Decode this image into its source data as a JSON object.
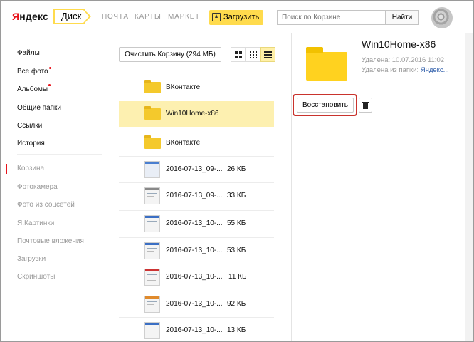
{
  "header": {
    "logo_text": "Яндекс",
    "disk_label": "Диск",
    "nav": [
      "ПОЧТА",
      "КАРТЫ",
      "МАРКЕТ"
    ],
    "upload_label": "Загрузить",
    "search_placeholder": "Поиск по Корзине",
    "search_button": "Найти"
  },
  "sidebar": {
    "items": [
      {
        "label": "Файлы"
      },
      {
        "label": "Все фото"
      },
      {
        "label": "Альбомы"
      },
      {
        "label": "Общие папки"
      },
      {
        "label": "Ссылки"
      },
      {
        "label": "История"
      },
      {
        "label": "Корзина"
      },
      {
        "label": "Фотокамера"
      },
      {
        "label": "Фото из соцсетей"
      },
      {
        "label": "Я.Картинки"
      },
      {
        "label": "Почтовые вложения"
      },
      {
        "label": "Загрузки"
      },
      {
        "label": "Скриншоты"
      }
    ]
  },
  "toolbar": {
    "clear_label": "Очистить Корзину (294 МБ)"
  },
  "files": [
    {
      "name": "ВКонтакте",
      "size": "",
      "type": "folder"
    },
    {
      "name": "Win10Home-x86",
      "size": "",
      "type": "folder",
      "selected": true
    },
    {
      "name": "ВКонтакте",
      "size": "",
      "type": "folder"
    },
    {
      "name": "2016-07-13_09-...",
      "size": "26 КБ",
      "type": "image"
    },
    {
      "name": "2016-07-13_09-...",
      "size": "33 КБ",
      "type": "image"
    },
    {
      "name": "2016-07-13_10-...",
      "size": "55 КБ",
      "type": "image"
    },
    {
      "name": "2016-07-13_10-...",
      "size": "53 КБ",
      "type": "image"
    },
    {
      "name": "2016-07-13_10-...",
      "size": "11 КБ",
      "type": "image"
    },
    {
      "name": "2016-07-13_10-...",
      "size": "92 КБ",
      "type": "image"
    },
    {
      "name": "2016-07-13_10-...",
      "size": "13 КБ",
      "type": "image"
    }
  ],
  "details": {
    "title": "Win10Home-x86",
    "deleted": "Удалена: 10.07.2016 11:02",
    "deleted_from_prefix": "Удалена из папки: ",
    "deleted_from_link": "Яндекс...",
    "restore_label": "Восстановить"
  },
  "colors": {
    "accent_yellow": "#ffdb4d",
    "selected_row": "#fdf0b0",
    "highlight_red": "#c9332d",
    "notify_dot": "#e8141b"
  }
}
